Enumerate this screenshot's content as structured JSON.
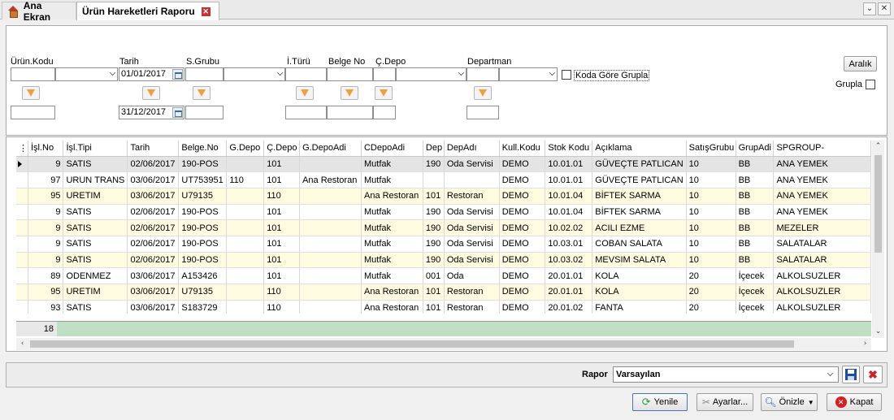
{
  "tabs": [
    {
      "label": "Ana Ekran",
      "icon": "home-icon"
    },
    {
      "label": "Ürün Hareketleri Raporu",
      "icon": "close-icon"
    }
  ],
  "filters": {
    "labels": {
      "urun_kodu": "Ürün.Kodu",
      "tarih": "Tarih",
      "s_grubu": "S.Grubu",
      "i_turu": "İ.Türü",
      "belge_no": "Belge No",
      "c_depo": "Ç.Depo",
      "departman": "Departman"
    },
    "date_start": "01/01/2017",
    "date_end": "31/12/2017",
    "group_by_code_label": "Koda Göre Grupla",
    "range_button": "Aralık",
    "group_label": "Grupla"
  },
  "grid": {
    "columns": [
      "İşl.No",
      "İşl.Tipi",
      "Tarih",
      "Belge.No",
      "G.Depo",
      "Ç.Depo",
      "G.DepoAdi",
      "CDepoAdi",
      "Dep",
      "DepAdı",
      "Kull.Kodu",
      "Stok Kodu",
      "Açıklama",
      "SatışGrubu",
      "GrupAdi",
      "SPGROUP-"
    ],
    "rows": [
      [
        "9",
        "SATIS",
        "02/06/2017",
        "190-POS",
        "",
        "101",
        "",
        "Mutfak",
        "190",
        "Oda Servisi",
        "DEMO",
        "10.01.01",
        "GÜVEÇTE PATLICAN",
        "10",
        "BB",
        "ANA YEMEK"
      ],
      [
        "97",
        "URUN TRANS",
        "03/06/2017",
        "UT753951",
        "110",
        "101",
        "Ana Restoran",
        "Mutfak",
        "",
        "",
        "DEMO",
        "10.01.01",
        "GÜVEÇTE PATLICAN",
        "10",
        "BB",
        "ANA YEMEK"
      ],
      [
        "95",
        "URETIM",
        "03/06/2017",
        "U79135",
        "",
        "110",
        "",
        "Ana Restoran",
        "101",
        "Restoran",
        "DEMO",
        "10.01.04",
        "BİFTEK SARMA",
        "10",
        "BB",
        "ANA YEMEK"
      ],
      [
        "9",
        "SATIS",
        "02/06/2017",
        "190-POS",
        "",
        "101",
        "",
        "Mutfak",
        "190",
        "Oda Servisi",
        "DEMO",
        "10.01.04",
        "BİFTEK SARMA",
        "10",
        "BB",
        "ANA YEMEK"
      ],
      [
        "9",
        "SATIS",
        "02/06/2017",
        "190-POS",
        "",
        "101",
        "",
        "Mutfak",
        "190",
        "Oda Servisi",
        "DEMO",
        "10.02.02",
        "ACILI EZME",
        "10",
        "BB",
        "MEZELER"
      ],
      [
        "9",
        "SATIS",
        "02/06/2017",
        "190-POS",
        "",
        "101",
        "",
        "Mutfak",
        "190",
        "Oda Servisi",
        "DEMO",
        "10.03.01",
        "COBAN SALATA",
        "10",
        "BB",
        "SALATALAR"
      ],
      [
        "9",
        "SATIS",
        "02/06/2017",
        "190-POS",
        "",
        "101",
        "",
        "Mutfak",
        "190",
        "Oda Servisi",
        "DEMO",
        "10.03.02",
        "MEVSIM SALATA",
        "10",
        "BB",
        "SALATALAR"
      ],
      [
        "89",
        "ODENMEZ",
        "03/06/2017",
        "A153426",
        "",
        "101",
        "",
        "Mutfak",
        "001",
        "Oda",
        "DEMO",
        "20.01.01",
        "KOLA",
        "20",
        "İçecek",
        "ALKOLSUZLER"
      ],
      [
        "95",
        "URETIM",
        "03/06/2017",
        "U79135",
        "",
        "110",
        "",
        "Ana Restoran",
        "101",
        "Restoran",
        "DEMO",
        "20.01.01",
        "KOLA",
        "20",
        "İçecek",
        "ALKOLSUZLER"
      ],
      [
        "93",
        "SATIS",
        "03/06/2017",
        "S183729",
        "",
        "110",
        "",
        "Ana Restoran",
        "101",
        "Restoran",
        "DEMO",
        "20.01.02",
        "FANTA",
        "20",
        "İçecek",
        "ALKOLSUZLER"
      ]
    ],
    "footer_count": "18"
  },
  "report": {
    "label": "Rapor",
    "selected": "Varsayılan"
  },
  "actions": {
    "refresh": "Yenile",
    "settings": "Ayarlar...",
    "preview": "Önizle",
    "close": "Kapat"
  },
  "colors": {
    "row_alt": "#fffbe0",
    "footer_bg": "#bfe0c4",
    "accent_orange": "#f0a040",
    "close_red": "#c83232"
  }
}
